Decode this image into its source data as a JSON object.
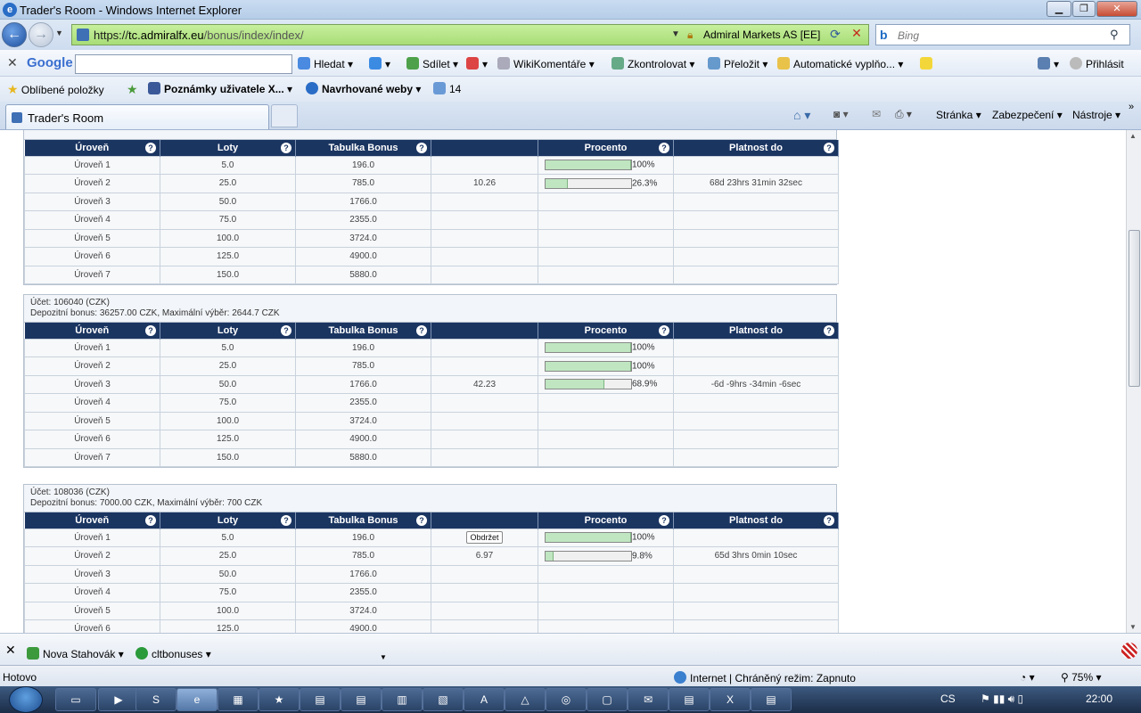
{
  "window": {
    "title": "Trader's Room - Windows Internet Explorer"
  },
  "address": {
    "url_scheme": "https://",
    "url_domain": "tc.admiralfx.eu",
    "url_path": "/bonus/index/index/",
    "certificate": "Admiral Markets AS [EE]"
  },
  "search": {
    "placeholder": "Bing"
  },
  "google_toolbar": {
    "brand": "Google",
    "search_btn": "Hledat",
    "share": "Sdílet",
    "wiki": "WikiKomentáře",
    "check": "Zkontrolovat",
    "translate": "Přeložit",
    "autofill": "Automatické vyplňo...",
    "signin": "Přihlásit"
  },
  "favorites": {
    "label": "Oblíbené položky",
    "item1": "Poznámky uživatele X...",
    "item2": "Navrhované weby",
    "item3": "14"
  },
  "tab": {
    "title": "Trader's Room"
  },
  "command_bar": {
    "page": "Stránka",
    "security": "Zabezpečení",
    "tools": "Nástroje"
  },
  "table_headers": {
    "level": "Úroveň",
    "lots": "Loty",
    "bonus_table": "Tabulka Bonus",
    "percent": "Procento",
    "valid_until": "Platnost do"
  },
  "accounts": [
    {
      "info_line1": "",
      "info_line2": "",
      "rows": [
        {
          "level": "Úroveň 1",
          "lots": "5.0",
          "bonus": "196.0",
          "extra": "",
          "progress": 100,
          "pct": "100%",
          "valid": ""
        },
        {
          "level": "Úroveň 2",
          "lots": "25.0",
          "bonus": "785.0",
          "extra": "10.26",
          "progress": 26.3,
          "pct": "26.3%",
          "valid": "68d 23hrs 31min 32sec"
        },
        {
          "level": "Úroveň 3",
          "lots": "50.0",
          "bonus": "1766.0",
          "extra": "",
          "progress": null,
          "pct": "",
          "valid": ""
        },
        {
          "level": "Úroveň 4",
          "lots": "75.0",
          "bonus": "2355.0",
          "extra": "",
          "progress": null,
          "pct": "",
          "valid": ""
        },
        {
          "level": "Úroveň 5",
          "lots": "100.0",
          "bonus": "3724.0",
          "extra": "",
          "progress": null,
          "pct": "",
          "valid": ""
        },
        {
          "level": "Úroveň 6",
          "lots": "125.0",
          "bonus": "4900.0",
          "extra": "",
          "progress": null,
          "pct": "",
          "valid": ""
        },
        {
          "level": "Úroveň 7",
          "lots": "150.0",
          "bonus": "5880.0",
          "extra": "",
          "progress": null,
          "pct": "",
          "valid": ""
        }
      ]
    },
    {
      "info_line1": "Účet: 106040 (CZK)",
      "info_line2": "Depozitní bonus: 36257.00 CZK, Maximální výběr: 2644.7 CZK",
      "rows": [
        {
          "level": "Úroveň 1",
          "lots": "5.0",
          "bonus": "196.0",
          "extra": "",
          "progress": 100,
          "pct": "100%",
          "valid": ""
        },
        {
          "level": "Úroveň 2",
          "lots": "25.0",
          "bonus": "785.0",
          "extra": "",
          "progress": 100,
          "pct": "100%",
          "valid": ""
        },
        {
          "level": "Úroveň 3",
          "lots": "50.0",
          "bonus": "1766.0",
          "extra": "42.23",
          "progress": 68.9,
          "pct": "68.9%",
          "valid": "-6d -9hrs -34min -6sec"
        },
        {
          "level": "Úroveň 4",
          "lots": "75.0",
          "bonus": "2355.0",
          "extra": "",
          "progress": null,
          "pct": "",
          "valid": ""
        },
        {
          "level": "Úroveň 5",
          "lots": "100.0",
          "bonus": "3724.0",
          "extra": "",
          "progress": null,
          "pct": "",
          "valid": ""
        },
        {
          "level": "Úroveň 6",
          "lots": "125.0",
          "bonus": "4900.0",
          "extra": "",
          "progress": null,
          "pct": "",
          "valid": ""
        },
        {
          "level": "Úroveň 7",
          "lots": "150.0",
          "bonus": "5880.0",
          "extra": "",
          "progress": null,
          "pct": "",
          "valid": ""
        }
      ]
    },
    {
      "info_line1": "Účet: 108036 (CZK)",
      "info_line2": "Depozitní bonus: 7000.00 CZK, Maximální výběr: 700 CZK",
      "rows": [
        {
          "level": "Úroveň 1",
          "lots": "5.0",
          "bonus": "196.0",
          "extra": "",
          "button": "Obdržet",
          "progress": 100,
          "pct": "100%",
          "valid": ""
        },
        {
          "level": "Úroveň 2",
          "lots": "25.0",
          "bonus": "785.0",
          "extra": "6.97",
          "progress": 9.8,
          "pct": "9.8%",
          "valid": "65d 3hrs 0min 10sec"
        },
        {
          "level": "Úroveň 3",
          "lots": "50.0",
          "bonus": "1766.0",
          "extra": "",
          "progress": null,
          "pct": "",
          "valid": ""
        },
        {
          "level": "Úroveň 4",
          "lots": "75.0",
          "bonus": "2355.0",
          "extra": "",
          "progress": null,
          "pct": "",
          "valid": ""
        },
        {
          "level": "Úroveň 5",
          "lots": "100.0",
          "bonus": "3724.0",
          "extra": "",
          "progress": null,
          "pct": "",
          "valid": ""
        },
        {
          "level": "Úroveň 6",
          "lots": "125.0",
          "bonus": "4900.0",
          "extra": "",
          "progress": null,
          "pct": "",
          "valid": ""
        }
      ]
    }
  ],
  "downloads": {
    "item1": "Nova Stahovák",
    "item2": "cltbonuses"
  },
  "status": {
    "left": "Hotovo",
    "zone": "Internet | Chráněný režim: Zapnuto",
    "zoom": "75%"
  },
  "taskbar": {
    "lang": "CS",
    "clock": "22:00"
  }
}
